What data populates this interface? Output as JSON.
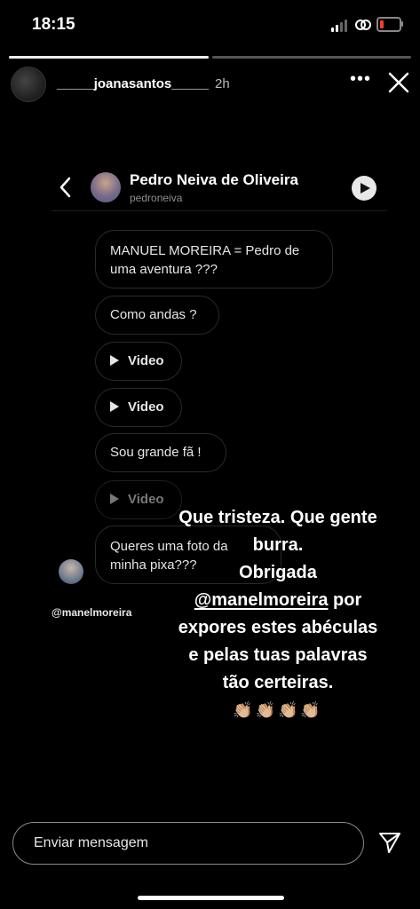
{
  "status_bar": {
    "time": "18:15",
    "battery_color": "#ff3b30"
  },
  "story": {
    "progress": [
      1.0,
      0.0
    ],
    "username": "_____joanasantos_____",
    "time_ago": "2h",
    "more_icon": "more-horizontal-icon",
    "close_icon": "close-icon"
  },
  "dm": {
    "name": "Pedro Neiva de Oliveira",
    "handle": "pedroneiva",
    "messages": [
      {
        "text": "MANUEL MOREIRA = Pedro de uma aventura ???"
      },
      {
        "text": "Como andas ?"
      },
      {
        "text": "Video"
      },
      {
        "text": "Video"
      },
      {
        "text": "Sou grande fã !"
      },
      {
        "text": "Video"
      },
      {
        "text": "Queres uma foto da minha pixa???"
      }
    ],
    "mention_tag": "@manelmoreira"
  },
  "caption": {
    "line1": "Que tristeza. Que gente burra.",
    "line2": "Obrigada",
    "mention": "@manelmoreira",
    "line3_rest": " por",
    "line4": "expores estes abéculas",
    "line5": "e pelas tuas palavras",
    "line6": "tão certeiras.",
    "emoji": "👏🏼👏🏼👏🏼👏🏼"
  },
  "footer": {
    "message_placeholder": "Enviar mensagem",
    "send_icon": "send-icon"
  }
}
